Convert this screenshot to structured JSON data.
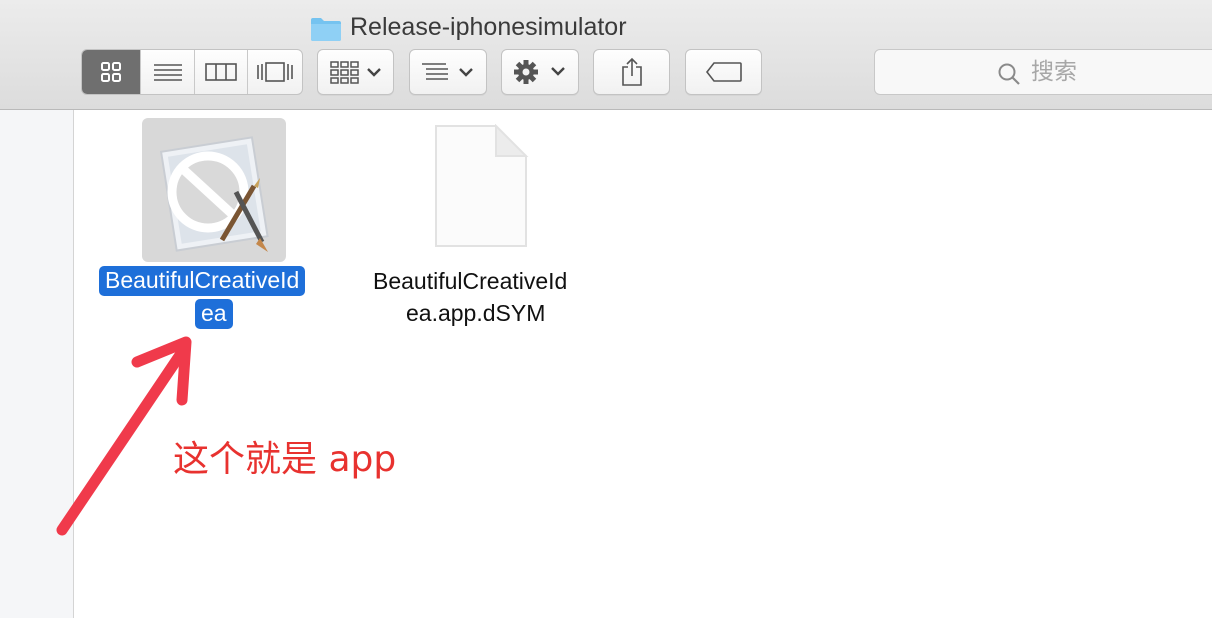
{
  "window": {
    "title": "Release-iphonesimulator",
    "folder_icon": "folder-icon"
  },
  "toolbar": {
    "view_modes": [
      {
        "name": "icon-view",
        "icon": "grid-icon",
        "active": true
      },
      {
        "name": "list-view",
        "icon": "list-icon",
        "active": false
      },
      {
        "name": "column-view",
        "icon": "columns-icon",
        "active": false
      },
      {
        "name": "cover-flow-view",
        "icon": "coverflow-icon",
        "active": false
      }
    ],
    "arrange_icon": "arrange-icon",
    "sort_icon": "sort-icon",
    "action_icon": "gear-icon",
    "share_icon": "share-icon",
    "tags_icon": "tag-icon"
  },
  "search": {
    "placeholder": "搜索"
  },
  "files": [
    {
      "name": "BeautifulCreativeIdea",
      "line1": "BeautifulCreativeId",
      "line2": "ea",
      "selected": true,
      "icon": "app-icon"
    },
    {
      "name": "BeautifulCreativeIdea.app.dSYM",
      "line1": "BeautifulCreativeId",
      "line2": "ea.app.dSYM",
      "selected": false,
      "icon": "document-icon"
    }
  ],
  "annotation": {
    "text": "这个就是 app",
    "color": "#e8322f"
  },
  "colors": {
    "selection": "#1e6fd9",
    "active_segment": "#6f6f6f"
  }
}
